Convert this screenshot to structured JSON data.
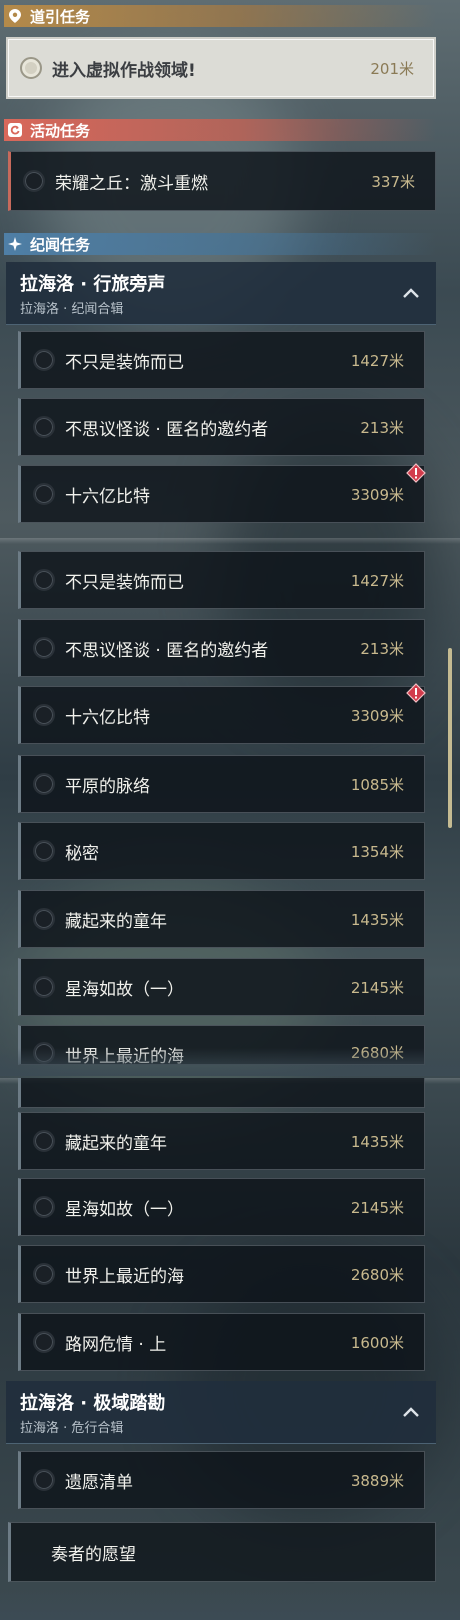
{
  "categories": {
    "guide": "道引任务",
    "event": "活动任务",
    "story": "纪闻任务"
  },
  "guide_quest": {
    "title": "进入虚拟作战领域!",
    "distance": "201米"
  },
  "event_quest": {
    "title": "荣耀之丘：激斗重燃",
    "distance": "337米"
  },
  "group1": {
    "title": "拉海洛 · 行旅旁声",
    "subtitle": "拉海洛 · 纪闻合辑",
    "chevron": "^"
  },
  "group2": {
    "title": "拉海洛 · 极域踏勘",
    "subtitle": "拉海洛 · 危行合辑",
    "chevron": "^"
  },
  "quests": [
    {
      "title": "不只是装饰而已",
      "distance": "1427米"
    },
    {
      "title": "不思议怪谈 · 匿名的邀约者",
      "distance": "213米"
    },
    {
      "title": "十六亿比特",
      "distance": "3309米",
      "warning": true
    },
    {
      "title": "平原的脉络",
      "distance": "1085米"
    },
    {
      "title": "秘密",
      "distance": "1354米"
    },
    {
      "title": "藏起来的童年",
      "distance": "1435米"
    },
    {
      "title": "星海如故（一）",
      "distance": "2145米"
    },
    {
      "title": "世界上最近的海",
      "distance": "2680米"
    },
    {
      "title": "路网危情 · 上",
      "distance": "1600米"
    }
  ],
  "group2_quests": [
    {
      "title": "遗愿清单",
      "distance": "3889米"
    },
    {
      "title": "奏者的愿望",
      "distance": ""
    }
  ],
  "icons": {
    "guide": "pin-icon",
    "event": "refresh-icon",
    "story": "sparkle-icon",
    "warning": "warning-diamond-icon"
  },
  "colors": {
    "guide": "#b48a4a",
    "event": "#d9685b",
    "story": "#4f7fa6",
    "distance": "#c8b98e",
    "warning": "#d23c4c"
  }
}
